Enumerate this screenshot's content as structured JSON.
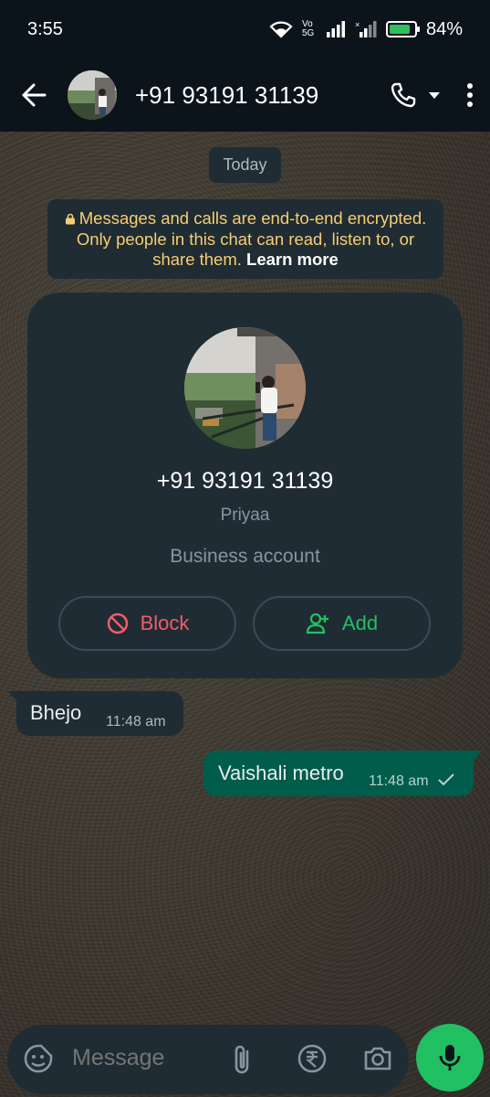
{
  "status_bar": {
    "time": "3:55",
    "battery_percent": "84%",
    "battery_level": 0.84,
    "network_label": "Vo 5G"
  },
  "header": {
    "title": "+91 93191 31139",
    "icons": [
      "back-arrow-icon",
      "phone-icon",
      "dropdown-icon",
      "more-vert-icon"
    ]
  },
  "chat": {
    "date_chip": "Today",
    "encryption_notice": "Messages and calls are end-to-end encrypted. Only people in this chat can read, listen to, or share them.",
    "encryption_link": "Learn more",
    "contact_card": {
      "phone": "+91 93191 31139",
      "name": "Priyaa",
      "account_type": "Business account",
      "block_label": "Block",
      "add_label": "Add"
    },
    "messages": [
      {
        "direction": "incoming",
        "text": "Bhejo",
        "time": "11:48 am"
      },
      {
        "direction": "outgoing",
        "text": "Vaishali metro",
        "time": "11:48 am",
        "status": "sent"
      }
    ]
  },
  "composer": {
    "placeholder": "Message"
  },
  "colors": {
    "header_bg": "#0b141a",
    "bubble_incoming": "#1f2c33",
    "bubble_outgoing": "#005c4b",
    "accent_green": "#21c063",
    "block_red": "#f15c6d",
    "encryption_text": "#f7cd73"
  }
}
